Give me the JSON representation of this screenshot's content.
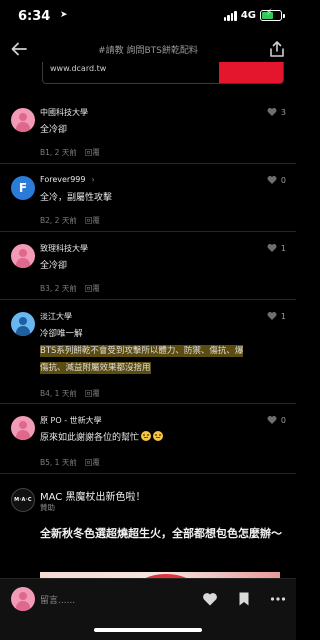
{
  "status_bar": {
    "time": "6:34",
    "network": "4G"
  },
  "header": {
    "title": "#請教 詢問BTS餅乾配料"
  },
  "link_preview": {
    "url": "www.dcard.tw"
  },
  "comments": [
    {
      "name": "中國科技大學",
      "text": "全冷卻",
      "floor": "B1, 2 天前",
      "reply": "回覆",
      "likes": "3"
    },
    {
      "name": "Forever999",
      "text": "全冷，副屬性攻擊",
      "floor": "B2, 2 天前",
      "reply": "回覆",
      "likes": "0",
      "avatar_letter": "F"
    },
    {
      "name": "致理科技大學",
      "text": "全冷卻",
      "floor": "B3, 2 天前",
      "reply": "回覆",
      "likes": "1"
    },
    {
      "name": "淡江大學",
      "text_line1": "冷卻唯一解",
      "text_highlight_1": "BTS系列餅乾不會受到攻擊所以體力、防禦、傷抗、爆",
      "text_highlight_2": "傷抗、減益附屬效果都沒捨用",
      "floor": "B4, 1 天前",
      "reply": "回覆",
      "likes": "1"
    },
    {
      "name": "原 PO - 世新大學",
      "text": "原來如此謝謝各位的幫忙",
      "floor": "B5, 1 天前",
      "reply": "回覆",
      "likes": "0"
    }
  ],
  "ad": {
    "logo_text": "M·A·C",
    "title": "MAC 黑魔杖出新色啦！",
    "sponsor": "贊助",
    "body": "全新秋冬色選超燒超生火，全部都想包色怎麼辦～"
  },
  "bottom_bar": {
    "placeholder": "留言......"
  },
  "colors": {
    "highlight": "#5b4d12",
    "ad_red": "#e3162e",
    "pink_avatar": "#f29bb6",
    "blue_avatar": "#68b7f0"
  },
  "icons": [
    "back-arrow-icon",
    "share-icon",
    "heart-icon",
    "bookmark-icon",
    "more-icon",
    "location-arrow-icon",
    "signal-icon",
    "battery-icon"
  ]
}
